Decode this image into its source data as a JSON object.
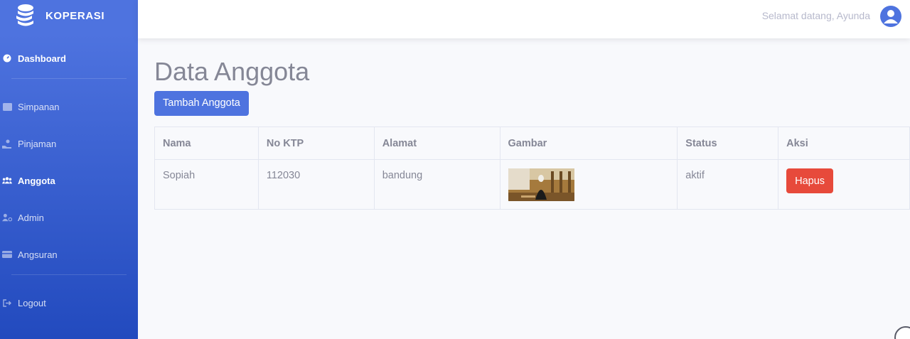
{
  "brand": {
    "name": "KOPERASI",
    "icon": "coins-stack-icon"
  },
  "sidebar": {
    "items": [
      {
        "label": "Dashboard",
        "icon": "tachometer-icon",
        "active": false,
        "bold": true
      },
      {
        "label": "Simpanan",
        "icon": "wallet-icon",
        "active": false
      },
      {
        "label": "Pinjaman",
        "icon": "hand-holding-icon",
        "active": false
      },
      {
        "label": "Anggota",
        "icon": "users-icon",
        "active": true
      },
      {
        "label": "Admin",
        "icon": "user-cog-icon",
        "active": false
      },
      {
        "label": "Angsuran",
        "icon": "credit-card-icon",
        "active": false
      },
      {
        "label": "Logout",
        "icon": "sign-out-icon",
        "active": false
      }
    ]
  },
  "topbar": {
    "welcome": "Selamat datang, Ayunda",
    "avatar_icon": "user-circle-icon"
  },
  "main": {
    "title": "Data Anggota",
    "add_button": "Tambah Anggota",
    "table": {
      "headers": [
        "Nama",
        "No KTP",
        "Alamat",
        "Gambar",
        "Status",
        "Aksi"
      ],
      "rows": [
        {
          "nama": "Sopiah",
          "no_ktp": "112030",
          "alamat": "bandung",
          "status": "aktif",
          "aksi": "Hapus"
        }
      ]
    }
  },
  "colors": {
    "primary": "#4e73df",
    "danger": "#e74a3b",
    "text": "#858796"
  }
}
